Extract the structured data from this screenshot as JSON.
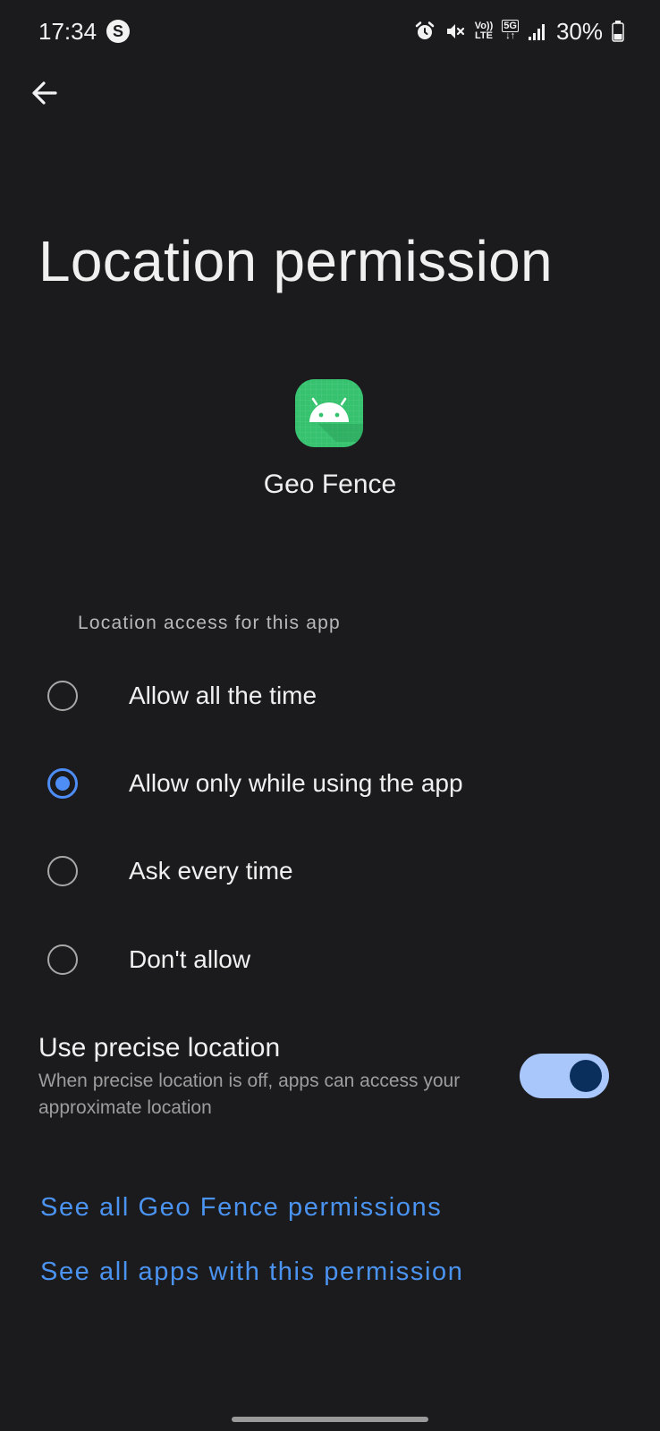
{
  "status_bar": {
    "time": "17:34",
    "s_badge": "S",
    "volte_top": "Vo))",
    "volte_bottom": "LTE",
    "network": "5G",
    "battery": "30%"
  },
  "icons": {
    "back": "arrow-left-icon",
    "alarm": "alarm-icon",
    "mute": "mute-icon",
    "signal": "signal-bars-icon",
    "battery": "battery-icon",
    "app": "android-icon"
  },
  "page": {
    "title": "Location permission",
    "app_name": "Geo Fence",
    "section_label": "Location access for this app"
  },
  "options": [
    {
      "label": "Allow all the time",
      "selected": false
    },
    {
      "label": "Allow only while using the app",
      "selected": true
    },
    {
      "label": "Ask every time",
      "selected": false
    },
    {
      "label": "Don't allow",
      "selected": false
    }
  ],
  "precise": {
    "title": "Use precise location",
    "description": "When precise location is off, apps can access your approximate location",
    "enabled": true
  },
  "links": {
    "app_permissions": "See all Geo Fence permissions",
    "apps_with_permission": "See all apps with this permission"
  },
  "colors": {
    "background": "#1b1b1d",
    "accent": "#4d8df5",
    "link": "#4b93f0",
    "toggle_track": "#a9c7fb",
    "toggle_thumb": "#0b2f5c",
    "app_icon": "#36c26e"
  }
}
